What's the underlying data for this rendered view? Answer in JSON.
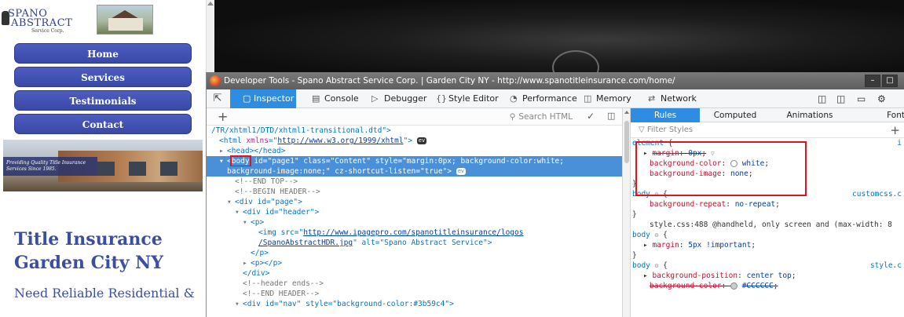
{
  "site": {
    "logo": {
      "line1": "SPANO",
      "line2": "ABSTRACT",
      "line3": "Service Corp."
    },
    "nav": [
      {
        "label": "Home"
      },
      {
        "label": "Services"
      },
      {
        "label": "Testimonials"
      },
      {
        "label": "Contact"
      }
    ],
    "banner_tagline": "Providing Quality Title Insurance Services Since 1985.",
    "heading": "Title Insurance Garden City NY",
    "subheading": "Need Reliable Residential &"
  },
  "devtools": {
    "window_title": "Developer Tools - Spano Abstract Service Corp. | Garden City NY - http://www.spanotitleinsurance.com/home/",
    "window_controls": [
      "minimize",
      "maximize"
    ],
    "tabs": [
      {
        "label": "Inspector",
        "icon": "inspector-icon",
        "active": true
      },
      {
        "label": "Console",
        "icon": "console-icon"
      },
      {
        "label": "Debugger",
        "icon": "debugger-icon"
      },
      {
        "label": "Style Editor",
        "icon": "braces-icon"
      },
      {
        "label": "Performance",
        "icon": "gauge-icon"
      },
      {
        "label": "Memory",
        "icon": "memory-icon"
      },
      {
        "label": "Network",
        "icon": "network-icon"
      }
    ],
    "markup": {
      "search_placeholder": "Search HTML",
      "lines": {
        "l0": "/TR/xhtml1/DTD/xhtml1-transitional.dtd\">",
        "l1_tag_open": "<html ",
        "l1_attr": "xmlns",
        "l1_eq": "=\"",
        "l1_link": "http://www.w3.org/1999/xhtml",
        "l1_close": "\">",
        "l2": "<head></head>",
        "l3_tag": "body",
        "l3_rest1": " id=\"page1\" class=\"Content\" style=\"margin:0px; background-color:white;",
        "l3_rest2": "background-image:none;\" cz-shortcut-listen=\"true\">",
        "l4": "<!--END TOP-->",
        "l5": "<!--BEGIN HEADER-->",
        "l6": "<div id=\"page\">",
        "l7": "<div id=\"header\">",
        "l8": "<p>",
        "l9_a": "<img src=\"",
        "l9_link": "http://www.ipagepro.com/spanotitleinsurance/logos",
        "l10_link": "/SpanoAbstractHDR.jpg",
        "l10_b": "\" alt=\"Spano Abstract Service\">",
        "l11": "</p>",
        "l12": "<p></p>",
        "l13": "</div>",
        "l14": "<!--header ends-->",
        "l15": "<!--END HEADER-->",
        "l16": "<div id=\"nav\" style=\"background-color:#3b59c4\">",
        "event_badge": "ev"
      }
    },
    "sidebar_tabs": [
      {
        "label": "Rules",
        "active": true
      },
      {
        "label": "Computed"
      },
      {
        "label": "Animations"
      },
      {
        "label": "Font"
      }
    ],
    "filter_placeholder": "Filter Styles",
    "rules": {
      "r0_sel": "element",
      "r0_brace": " {",
      "r0_src": "i",
      "r1_prop": "margin",
      "r1_val": "0px",
      "r2_prop": "background-color",
      "r2_val": "white",
      "r3_prop": "background-image",
      "r3_val": "none",
      "r4": "}",
      "r5_sel": "body",
      "r5_src": "customcss.c",
      "r6_prop": "background-repeat",
      "r6_val": "no-repeat",
      "r7": "}",
      "r8_media": "style.css:488 @handheld, only screen and (max-width: 8",
      "r9_sel": "body",
      "r10_prop": "margin",
      "r10_val": "5px !important",
      "r11": "}",
      "r12_sel": "body",
      "r12_src": "style.c",
      "r13_prop": "background-position",
      "r13_val": "center top",
      "r14_prop": "background-color",
      "r14_val": "#CCCCCC"
    }
  },
  "colors": {
    "nav_button": "#3a49a8",
    "heading": "#3c4ea0",
    "devtools_accent": "#2e8de0",
    "highlight_box": "#e0141e"
  }
}
